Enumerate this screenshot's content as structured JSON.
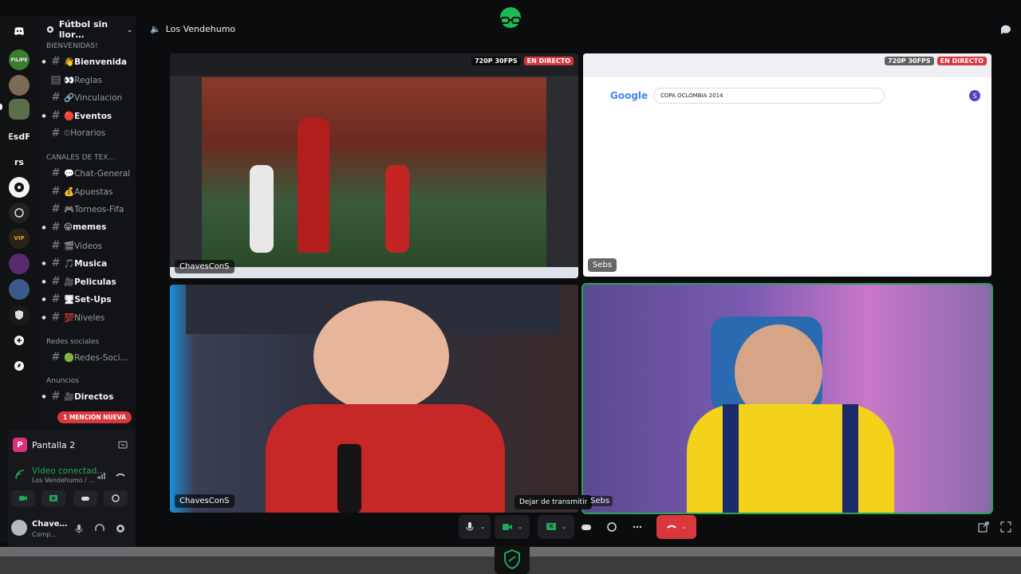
{
  "guild": {
    "name": "Fútbol sin llor…"
  },
  "servers": [
    {
      "label": "FILIPE"
    },
    {
      "label": "EsdF"
    },
    {
      "label": "rs"
    }
  ],
  "categories": {
    "bienvenidas": "BIENVENIDAS!",
    "canales": "CANALES DE TEX…",
    "redes": "Redes sociales",
    "anuncios": "Anuncios"
  },
  "channels": [
    {
      "label": "👋Bienvenida",
      "unread": true,
      "arrow": true
    },
    {
      "label": "👀Reglas",
      "unread": false,
      "arrow": false
    },
    {
      "label": "🔗Vinculacion",
      "unread": false,
      "arrow": false
    },
    {
      "label": "🔴Eventos",
      "unread": true,
      "arrow": true
    },
    {
      "label": "⏲Horarios",
      "unread": false,
      "arrow": false
    },
    {
      "label": "💬Chat-General",
      "unread": false,
      "arrow": false
    },
    {
      "label": "💰Apuestas",
      "unread": false,
      "arrow": false
    },
    {
      "label": "🎮Torneos-Fifa",
      "unread": false,
      "arrow": false
    },
    {
      "label": "😛memes",
      "unread": true,
      "arrow": true
    },
    {
      "label": "🎬Videos",
      "unread": false,
      "arrow": false
    },
    {
      "label": "🎵Musica",
      "unread": true,
      "arrow": true
    },
    {
      "label": "🎥Peliculas",
      "unread": true,
      "arrow": true
    },
    {
      "label": "🖥Set-Ups",
      "unread": true,
      "arrow": true
    },
    {
      "label": "💯Niveles",
      "unread": false,
      "arrow": true
    },
    {
      "label": "🟢Redes-Soci…",
      "unread": false,
      "arrow": false
    },
    {
      "label": "🎥Directos",
      "unread": true,
      "arrow": true
    }
  ],
  "mention_pill": "1 MENCIÓN NUEVA",
  "stream_panel": {
    "title": "Pantalla 2",
    "status": "Vídeo conectad…",
    "subtitle": "Los Vendehumo / …"
  },
  "user": {
    "name": "Chave…",
    "status": "Comp…"
  },
  "stage": {
    "title": "Los Vendehumo"
  },
  "tiles": [
    {
      "name": "ChavesConS",
      "quality": "720P 30FPS",
      "live": "EN DIRECTO",
      "kind": "screen-football"
    },
    {
      "name": "Sebs",
      "quality": "720P 30FPS",
      "live": "EN DIRECTO",
      "kind": "screen-google",
      "search": "COPA OCLOMBIA 2014",
      "brand": "Google"
    },
    {
      "name": "ChavesConS",
      "kind": "camera-red"
    },
    {
      "name": "Sebs",
      "kind": "camera-yellow"
    }
  ],
  "tooltip": "Dejar de transmitir",
  "tooltip_name": "Sebs",
  "colors": {
    "accent": "#23a55a",
    "danger": "#da373c",
    "live": "#da373c",
    "pink": "#e02f7c"
  }
}
